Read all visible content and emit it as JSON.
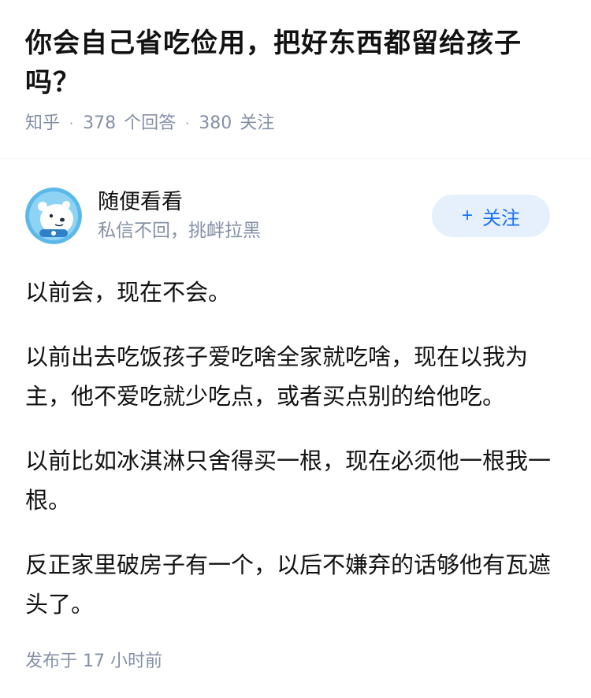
{
  "question": {
    "title": "你会自己省吃俭用，把好东西都留给孩子吗？",
    "source": "知乎",
    "answer_count": "378",
    "answer_label": "个回答",
    "follow_count": "380",
    "follow_label": "关注"
  },
  "author": {
    "name": "随便看看",
    "bio": "私信不回，挑衅拉黑",
    "avatar_icon": "polar-bear-astronaut-avatar",
    "follow_button": {
      "plus": "+",
      "label": "关注"
    }
  },
  "answer": {
    "paragraphs": [
      "以前会，现在不会。",
      "以前出去吃饭孩子爱吃啥全家就吃啥，现在以我为主，他不爱吃就少吃点，或者买点别的给他吃。",
      "以前比如冰淇淋只舍得买一根，现在必须他一根我一根。",
      "反正家里破房子有一个，以后不嫌弃的话够他有瓦遮头了。"
    ],
    "published_label": "发布于",
    "published_time": "17 小时前"
  },
  "colors": {
    "accent": "#1772f6",
    "follow_bg": "#e5f0fc",
    "meta_gray": "#8590a6",
    "text": "#121212"
  }
}
